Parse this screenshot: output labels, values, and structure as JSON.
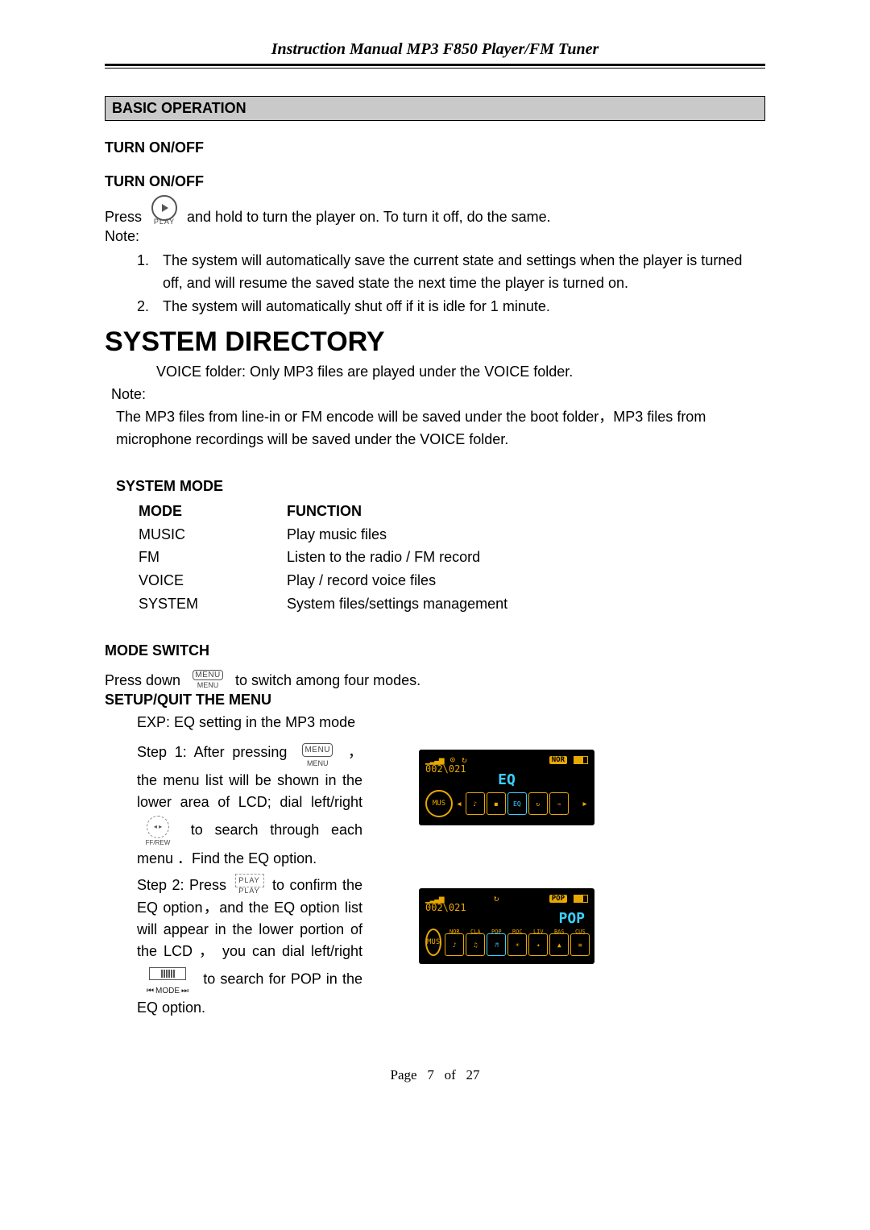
{
  "header_title": "Instruction Manual MP3 F850 Player/FM Tuner",
  "basic_operation": {
    "bar": "BASIC OPERATION",
    "turn_on_off_1": "TURN ON/OFF",
    "turn_on_off_2": "TURN ON/OFF",
    "press": "Press",
    "play_label": "PLAY",
    "press_tail": "and hold to turn the player on. To turn it off, do the same.",
    "note_label": "Note:",
    "notes": [
      "The system will automatically save the current state and settings when the player is turned off, and will resume the saved state the next time the player is turned on.",
      "The system will automatically shut off if it is idle for 1 minute."
    ]
  },
  "system_directory": {
    "heading": "SYSTEM DIRECTORY",
    "voice_line": "VOICE folder: Only MP3 files are played under the VOICE folder.",
    "note_label": "Note:",
    "note_body": "The MP3 files from line-in or FM encode will be saved under the boot folder，MP3 files from microphone recordings will be saved under the VOICE folder."
  },
  "system_mode": {
    "heading": "SYSTEM MODE",
    "col_mode": "MODE",
    "col_function": "FUNCTION",
    "rows": [
      {
        "mode": "MUSIC",
        "func": "Play music files"
      },
      {
        "mode": "FM",
        "func": "Listen to the radio / FM record"
      },
      {
        "mode": "VOICE",
        "func": "Play / record voice files"
      },
      {
        "mode": "SYSTEM",
        "func": "System files/settings management"
      }
    ]
  },
  "mode_switch": {
    "heading": "MODE SWITCH",
    "press_down": "Press down",
    "menu_label": "MENU",
    "press_tail": "to switch among four modes."
  },
  "setup_quit": {
    "heading": "SETUP/QUIT THE MENU",
    "exp": "EXP: EQ setting in the MP3 mode",
    "step1_lead": "Step 1: After pressing",
    "step1_tail": " ，the menu list will be shown in the lower area of LCD; dial left/right",
    "step1_end": "to search through each menu ．Find the EQ option.",
    "ffrew_label": "FF/REW",
    "step2_lead": "Step 2: Press",
    "play_label": "PLAY",
    "step2_a": "to confirm the EQ option，and the EQ option list will appear in the lower portion of the LCD ， you can dial left/right",
    "mode_label": "MODE",
    "step2_b": "to search for POP in the EQ option."
  },
  "lcd1": {
    "counter": "002\\021",
    "badge": "NOR",
    "main": "EQ",
    "mus": "MUS",
    "items": [
      "♪",
      "◼",
      "EQ",
      "↻",
      "→"
    ]
  },
  "lcd2": {
    "counter": "002\\021",
    "badge": "POP",
    "main": "POP",
    "mus": "MUS",
    "caps": [
      "NOR",
      "CLA",
      "POP",
      "ROC",
      "LIV",
      "BAS",
      "CUS"
    ]
  },
  "footer": {
    "page_word": "Page",
    "page_num": "7",
    "of_word": "of",
    "page_total": "27"
  }
}
